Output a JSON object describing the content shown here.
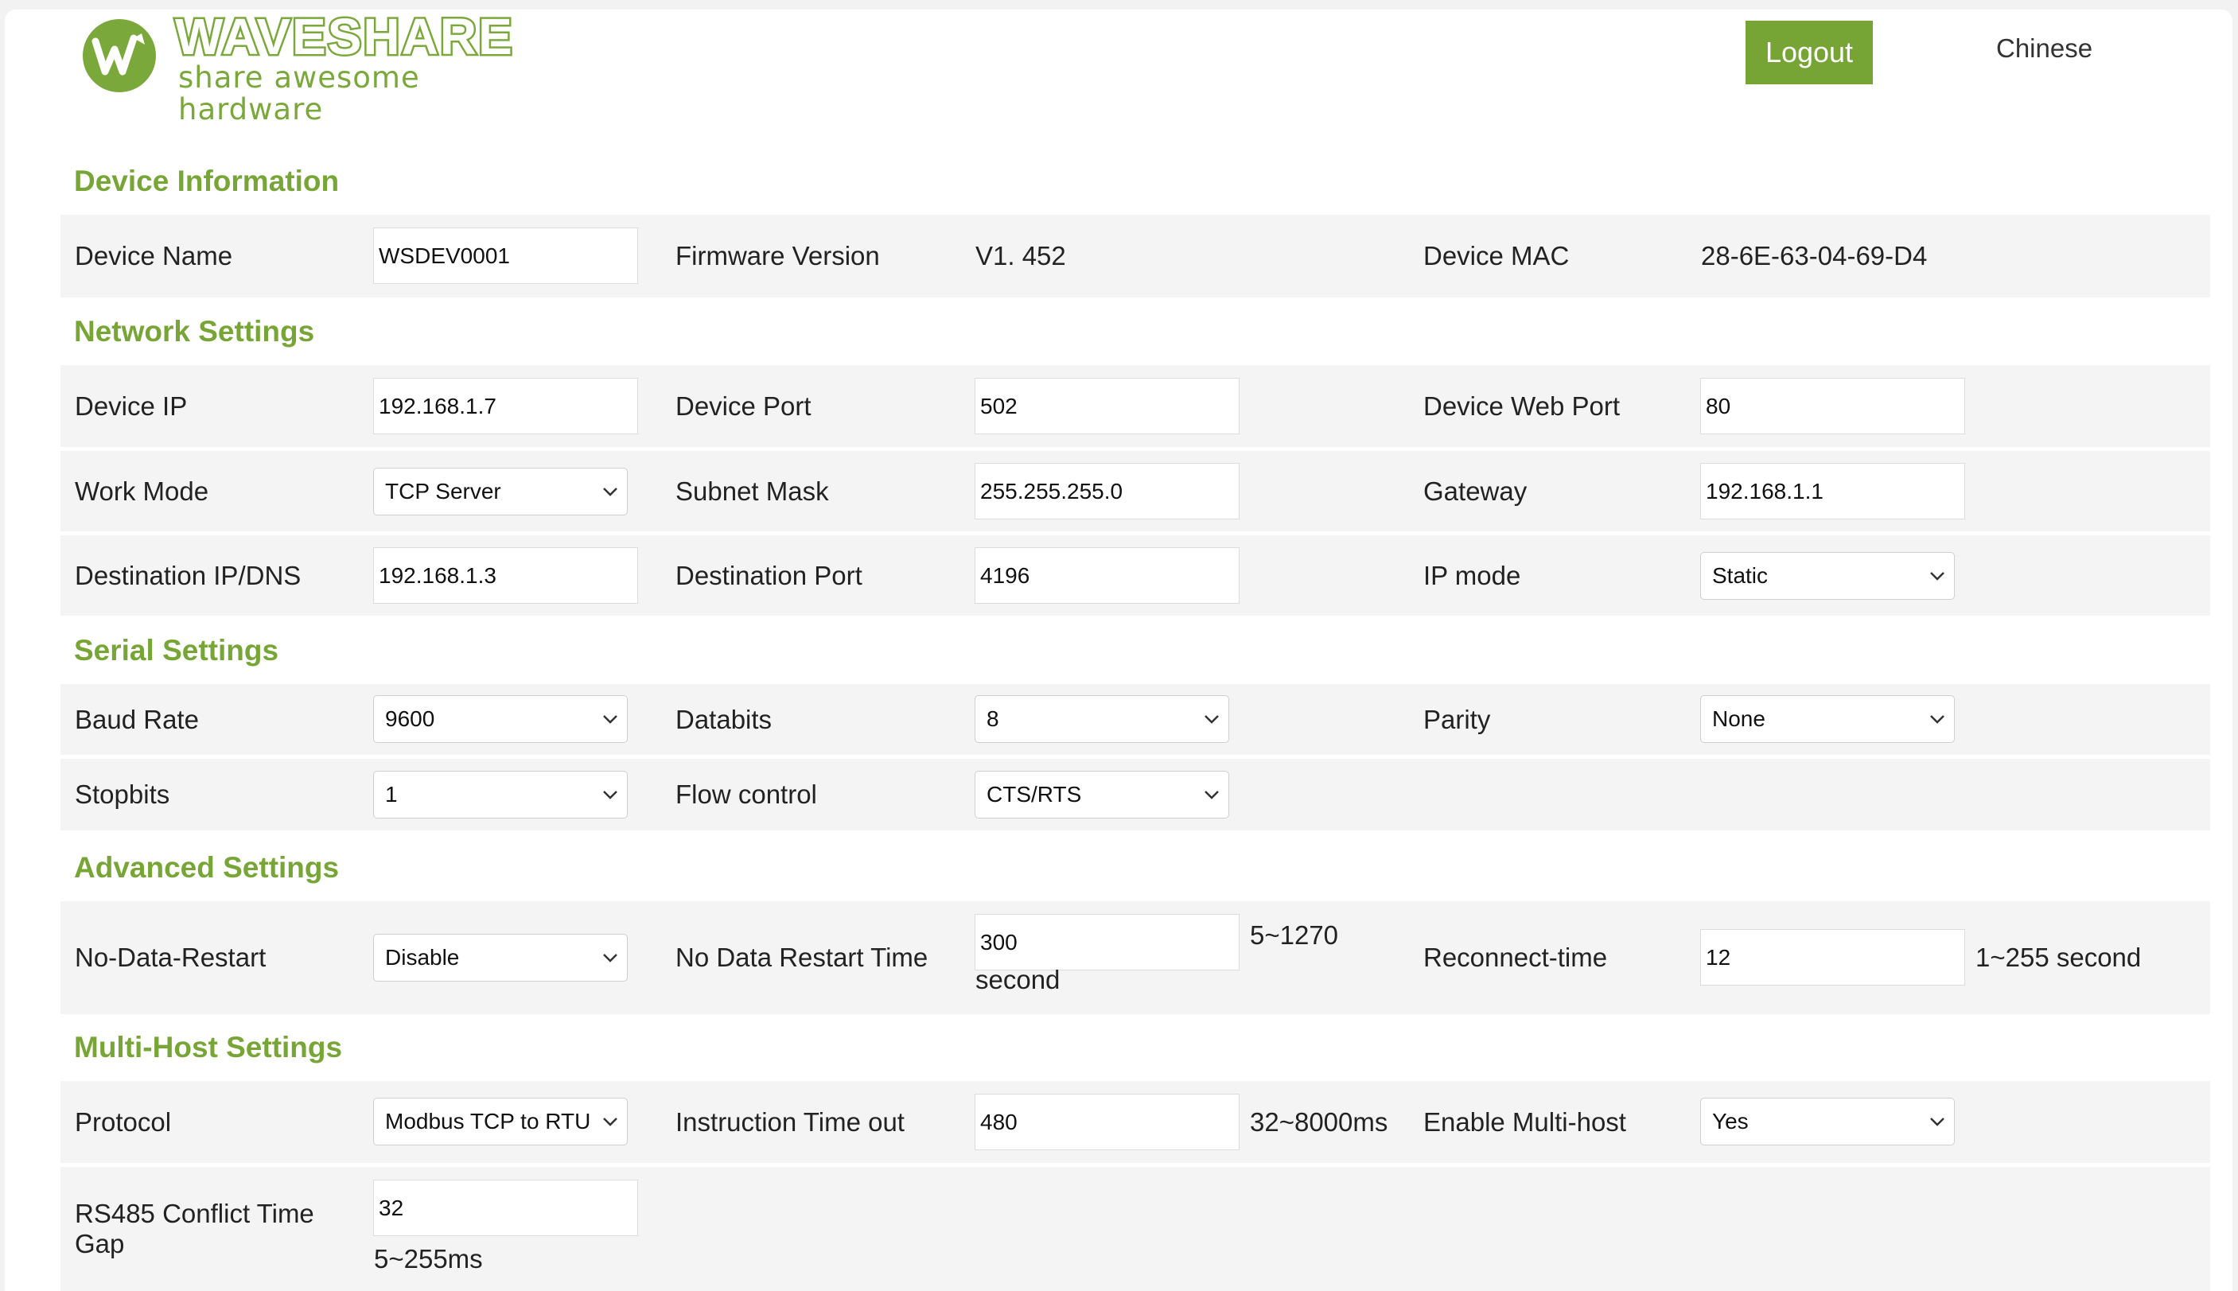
{
  "header": {
    "logo_main": "WAVESHARE",
    "logo_sub": "share awesome hardware",
    "logout_label": "Logout",
    "language_label": "Chinese"
  },
  "colors": {
    "accent": "#76a535",
    "row_background": "#f4f4f4"
  },
  "device_info": {
    "title": "Device Information",
    "device_name_label": "Device Name",
    "device_name_value": "WSDEV0001",
    "firmware_label": "Firmware Version",
    "firmware_value": "V1. 452",
    "mac_label": "Device MAC",
    "mac_value": "28-6E-63-04-69-D4"
  },
  "network": {
    "title": "Network Settings",
    "device_ip_label": "Device IP",
    "device_ip_value": "192.168.1.7",
    "device_port_label": "Device Port",
    "device_port_value": "502",
    "web_port_label": "Device Web Port",
    "web_port_value": "80",
    "work_mode_label": "Work Mode",
    "work_mode_value": "TCP Server",
    "subnet_label": "Subnet Mask",
    "subnet_value": "255.255.255.0",
    "gateway_label": "Gateway",
    "gateway_value": "192.168.1.1",
    "dest_ip_label": "Destination IP/DNS",
    "dest_ip_value": "192.168.1.3",
    "dest_port_label": "Destination Port",
    "dest_port_value": "4196",
    "ip_mode_label": "IP mode",
    "ip_mode_value": "Static"
  },
  "serial": {
    "title": "Serial Settings",
    "baud_label": "Baud Rate",
    "baud_value": "9600",
    "databits_label": "Databits",
    "databits_value": "8",
    "parity_label": "Parity",
    "parity_value": "None",
    "stopbits_label": "Stopbits",
    "stopbits_value": "1",
    "flow_label": "Flow control",
    "flow_value": "CTS/RTS"
  },
  "advanced": {
    "title": "Advanced Settings",
    "ndr_label": "No-Data-Restart",
    "ndr_value": "Disable",
    "ndr_time_label": "No Data Restart Time",
    "ndr_time_value": "300",
    "ndr_time_range": "5~1270",
    "ndr_time_unit": "second",
    "reconnect_label": "Reconnect-time",
    "reconnect_value": "12",
    "reconnect_range": "1~255 second"
  },
  "multihost": {
    "title": "Multi-Host Settings",
    "protocol_label": "Protocol",
    "protocol_value": "Modbus TCP to RTU",
    "timeout_label": "Instruction Time out",
    "timeout_value": "480",
    "timeout_range": "32~8000ms",
    "enable_label": "Enable Multi-host",
    "enable_value": "Yes",
    "conflict_label": "RS485 Conflict Time Gap",
    "conflict_value": "32",
    "conflict_range": "5~255ms"
  }
}
